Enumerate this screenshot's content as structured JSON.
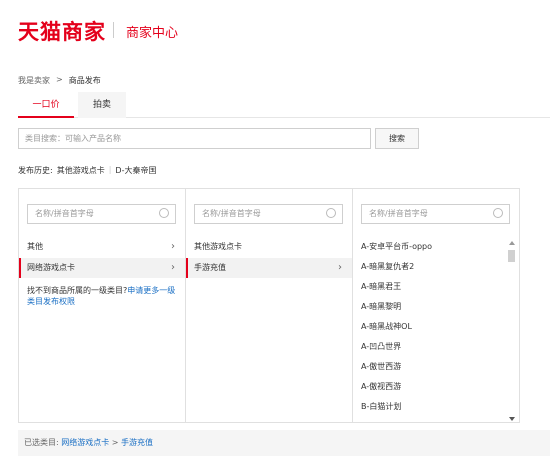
{
  "header": {
    "logo": "天猫商家",
    "subtitle": "商家中心"
  },
  "breadcrumb": {
    "items": [
      "我是卖家",
      "商品发布"
    ],
    "separator": ">"
  },
  "tabs": [
    {
      "label": "一口价",
      "active": true
    },
    {
      "label": "拍卖",
      "active": false
    }
  ],
  "search": {
    "placeholder": "类目搜索：可输入产品名称",
    "button": "搜索"
  },
  "history": {
    "label": "发布历史:",
    "items": [
      "其他游戏点卡",
      "D-大秦帝国"
    ],
    "separator": "|"
  },
  "columns": [
    {
      "search_placeholder": "名称/拼音首字母",
      "items": [
        {
          "label": "其他",
          "selected": false
        },
        {
          "label": "网络游戏点卡",
          "selected": true
        }
      ],
      "note": {
        "text": "找不到商品所属的一级类目?",
        "link": "申请更多一级类目发布权限"
      }
    },
    {
      "search_placeholder": "名称/拼音首字母",
      "items": [
        {
          "label": "其他游戏点卡",
          "selected": false
        },
        {
          "label": "手游充值",
          "selected": true
        }
      ]
    },
    {
      "search_placeholder": "名称/拼音首字母",
      "items": [
        "A-安卓平台币-oppo",
        "A-暗黑复仇者2",
        "A-暗黑君王",
        "A-暗黑黎明",
        "A-暗黑战神OL",
        "A-凹凸世界",
        "A-傲世西游",
        "A-傲视西游",
        "B-白猫计划"
      ]
    }
  ],
  "selected": {
    "label": "已选类目:",
    "path1": "网络游戏点卡",
    "sep": ">",
    "path2": "手游充值"
  },
  "colors": {
    "brand": "#e4001b",
    "link": "#1a6fc4"
  }
}
